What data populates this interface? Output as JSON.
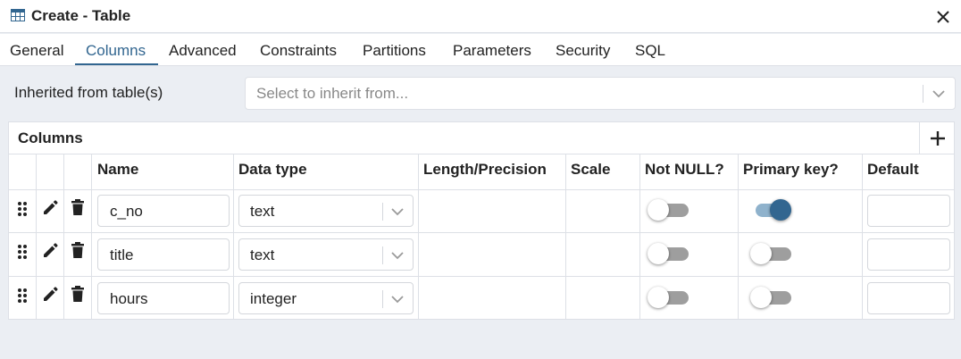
{
  "window": {
    "title": "Create - Table",
    "background_text": "...",
    "close_icon": "close-icon"
  },
  "tabs": [
    {
      "label": "General"
    },
    {
      "label": "Columns",
      "active": true
    },
    {
      "label": "Advanced"
    },
    {
      "label": "Constraints"
    },
    {
      "label": "Partitions"
    },
    {
      "label": "Parameters"
    },
    {
      "label": "Security"
    },
    {
      "label": "SQL"
    }
  ],
  "inherit": {
    "label": "Inherited from table(s)",
    "placeholder": "Select to inherit from..."
  },
  "columns_panel": {
    "title": "Columns",
    "add_icon": "plus-icon",
    "headers": [
      "Name",
      "Data type",
      "Length/Precision",
      "Scale",
      "Not NULL?",
      "Primary key?",
      "Default"
    ],
    "rows": [
      {
        "name": "c_no",
        "data_type": "text",
        "length": "",
        "scale": "",
        "not_null": false,
        "primary_key": true,
        "default": ""
      },
      {
        "name": "title",
        "data_type": "text",
        "length": "",
        "scale": "",
        "not_null": false,
        "primary_key": false,
        "default": ""
      },
      {
        "name": "hours",
        "data_type": "integer",
        "length": "",
        "scale": "",
        "not_null": false,
        "primary_key": false,
        "default": ""
      }
    ]
  },
  "colors": {
    "accent": "#326690",
    "toggle_on_track": "#8fb2cc",
    "toggle_off_track": "#9e9e9e",
    "background": "#ebeef3"
  }
}
